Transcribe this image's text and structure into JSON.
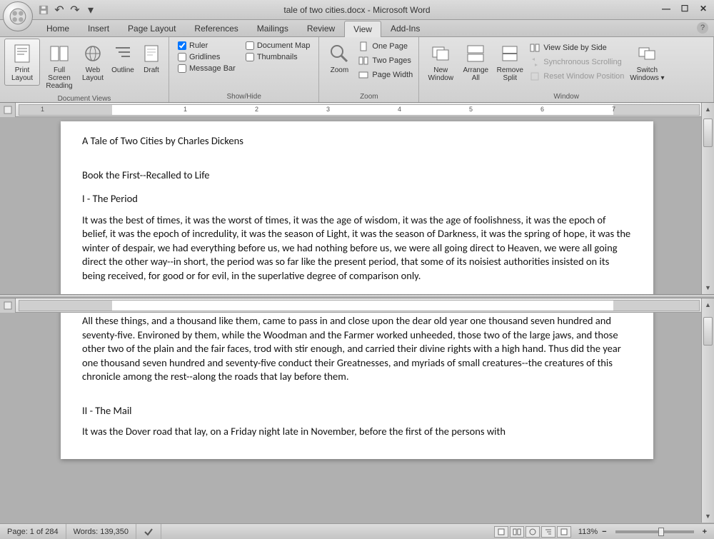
{
  "titlebar": {
    "document_title": "tale of two cities.docx - Microsoft Word"
  },
  "tabs": {
    "items": [
      "Home",
      "Insert",
      "Page Layout",
      "References",
      "Mailings",
      "Review",
      "View",
      "Add-Ins"
    ],
    "active_index": 6
  },
  "ribbon": {
    "document_views": {
      "label": "Document Views",
      "print_layout": "Print Layout",
      "full_screen_reading": "Full Screen Reading",
      "web_layout": "Web Layout",
      "outline": "Outline",
      "draft": "Draft"
    },
    "show_hide": {
      "label": "Show/Hide",
      "ruler": "Ruler",
      "gridlines": "Gridlines",
      "message_bar": "Message Bar",
      "document_map": "Document Map",
      "thumbnails": "Thumbnails"
    },
    "zoom": {
      "label": "Zoom",
      "zoom_btn": "Zoom",
      "one_page": "One Page",
      "two_pages": "Two Pages",
      "page_width": "Page Width"
    },
    "window": {
      "label": "Window",
      "new_window": "New Window",
      "arrange_all": "Arrange All",
      "remove_split": "Remove Split",
      "view_side_by_side": "View Side by Side",
      "synchronous_scrolling": "Synchronous Scrolling",
      "reset_window_position": "Reset Window Position",
      "switch_windows": "Switch Windows"
    }
  },
  "ruler_numbers": [
    "1",
    "1",
    "2",
    "3",
    "4",
    "5",
    "6",
    "7"
  ],
  "document": {
    "title_line": "A Tale of Two Cities  by Charles Dickens",
    "book_line": "Book the First--Recalled to Life",
    "chapter1": " I - The Period",
    "para1": "It was the best of times, it was the worst of times, it was the age of wisdom, it was the age of foolishness, it was the epoch of belief, it was the epoch of incredulity, it was the season of Light, it was the season of Darkness, it was the spring of hope, it was the winter of despair, we had everything before us, we had nothing before us, we were all going direct to Heaven, we were all going direct the other way--in short, the period was so far like the present period, that some of its noisiest authorities insisted on its being received, for good or for evil, in the superlative degree of comparison only.",
    "para2_partial": "All these things, and a thousand like them, came to pass in and close upon the dear old year one thousand seven hundred and seventy-five.  Environed by them, while the Woodman and the Farmer worked unheeded, those two of the large jaws, and those other two of the plain and the fair faces, trod with stir enough, and carried their divine rights with a high hand.  Thus did the year one thousand seven hundred and seventy-five conduct their Greatnesses, and myriads of small creatures--the creatures of this chronicle among the rest--along the roads that lay before them.",
    "chapter2": "II - The Mail",
    "para3_partial": " It was the Dover road that lay, on a Friday night late in November, before the first of the persons with"
  },
  "statusbar": {
    "page": "Page: 1 of 284",
    "words": "Words: 139,350",
    "zoom_pct": "113%"
  }
}
